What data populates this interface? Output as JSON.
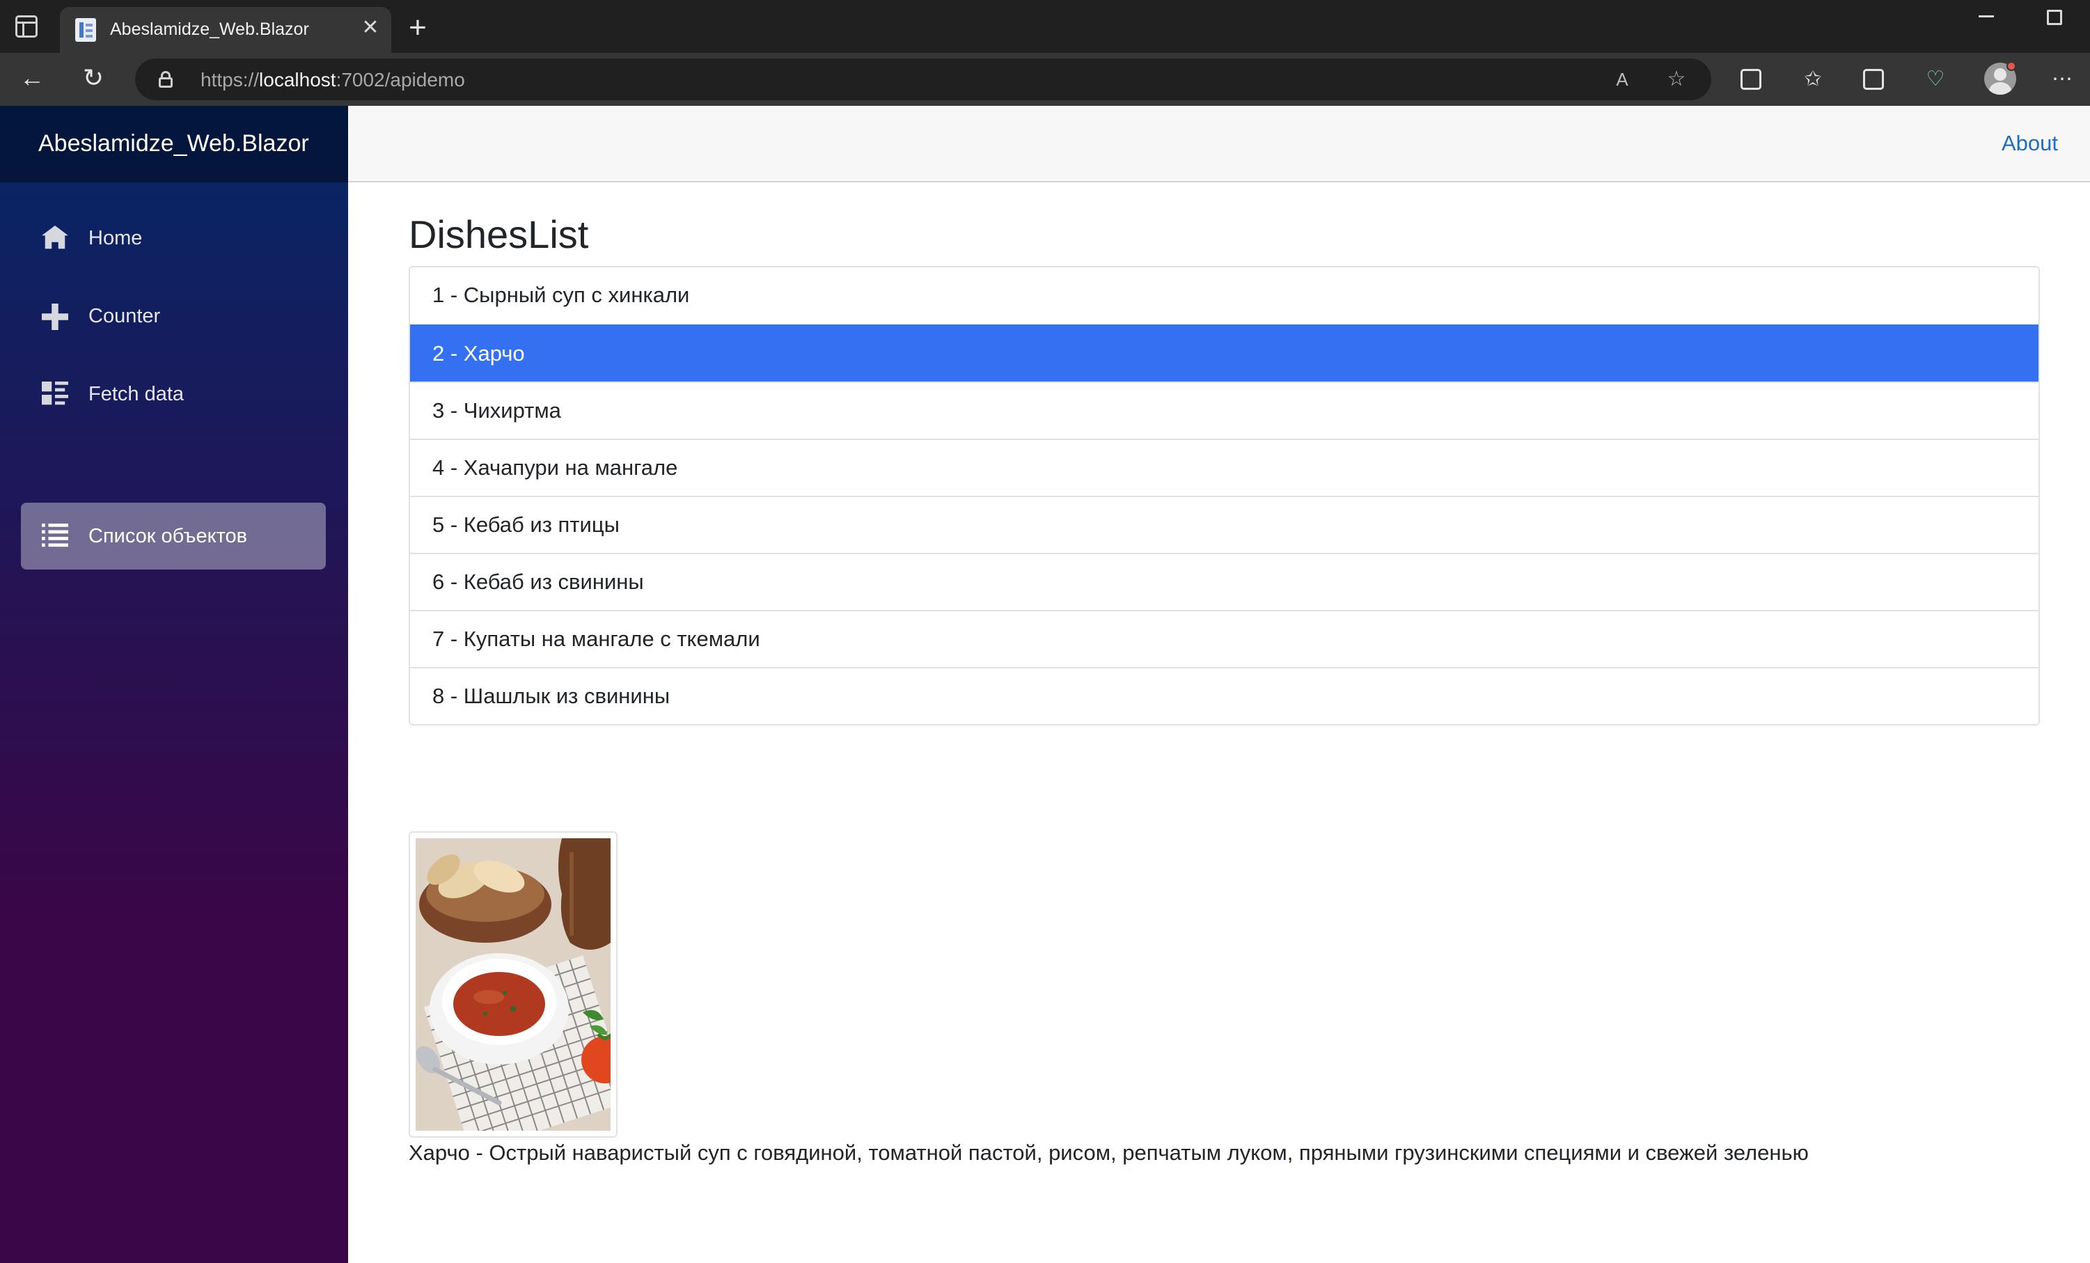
{
  "browser": {
    "tab_title": "Abeslamidze_Web.Blazor",
    "url_scheme": "https://",
    "url_host": "localhost",
    "url_rest": ":7002/apidemo"
  },
  "app": {
    "brand": "Abeslamidze_Web.Blazor",
    "about": "About"
  },
  "sidebar": {
    "items": [
      {
        "label": "Home",
        "icon": "home-icon"
      },
      {
        "label": "Counter",
        "icon": "plus-icon"
      },
      {
        "label": "Fetch data",
        "icon": "list-rich-icon"
      },
      {
        "label": "Список объектов",
        "icon": "list-icon",
        "active": true
      }
    ]
  },
  "main": {
    "title": "DishesList",
    "dishes": [
      {
        "label": "1 - Сырный суп с хинкали"
      },
      {
        "label": "2 - Харчо",
        "selected": true
      },
      {
        "label": "3 - Чихиртма"
      },
      {
        "label": "4 - Хачапури на мангале"
      },
      {
        "label": "5 - Кебаб из птицы"
      },
      {
        "label": "6 - Кебаб из свинины"
      },
      {
        "label": "7 - Купаты на мангале с ткемали"
      },
      {
        "label": "8 - Шашлык из свинины"
      }
    ],
    "description": "Харчо - Острый наваристый суп с говядиной, томатной пастой, рисом, репчатым луком, пряными грузинскими специями и свежей зеленью"
  },
  "colors": {
    "accent": "#3370f2",
    "link": "#1b6ec2",
    "sidebar_top": "#052767",
    "sidebar_bottom": "#3a0647"
  }
}
